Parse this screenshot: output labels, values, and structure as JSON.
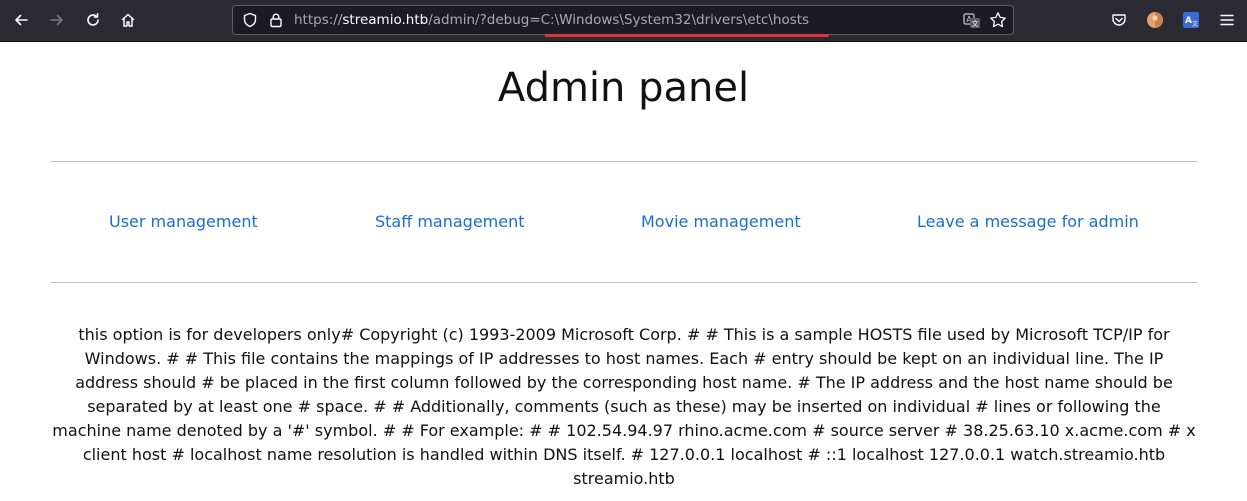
{
  "browser": {
    "url": {
      "scheme": "https://",
      "host": "streamio.htb",
      "path": "/admin/?debug=C:\\Windows\\System32\\drivers\\etc\\hosts"
    },
    "colors": {
      "toolbar_bg": "#2b2a33",
      "url_bg": "#1c1b22",
      "underline": "#e0343c"
    },
    "icons": [
      "back-icon",
      "forward-icon",
      "reload-icon",
      "home-icon",
      "shield-icon",
      "lock-icon",
      "translate-icon",
      "star-icon",
      "pocket-icon",
      "account-icon",
      "extension-icon",
      "menu-icon"
    ]
  },
  "page": {
    "title": "Admin panel",
    "nav": {
      "users": "User management",
      "staff": "Staff management",
      "movies": "Movie management",
      "message": "Leave a message for admin"
    },
    "output_text": "this option is for developers only# Copyright (c) 1993-2009 Microsoft Corp. # # This is a sample HOSTS file used by Microsoft TCP/IP for Windows. # # This file contains the mappings of IP addresses to host names. Each # entry should be kept on an individual line. The IP address should # be placed in the first column followed by the corresponding host name. # The IP address and the host name should be separated by at least one # space. # # Additionally, comments (such as these) may be inserted on individual # lines or following the machine name denoted by a '#' symbol. # # For example: # # 102.54.94.97 rhino.acme.com # source server # 38.25.63.10 x.acme.com # x client host # localhost name resolution is handled within DNS itself. # 127.0.0.1 localhost # ::1 localhost 127.0.0.1 watch.streamio.htb streamio.htb",
    "link_color": "#1a6dd4"
  }
}
